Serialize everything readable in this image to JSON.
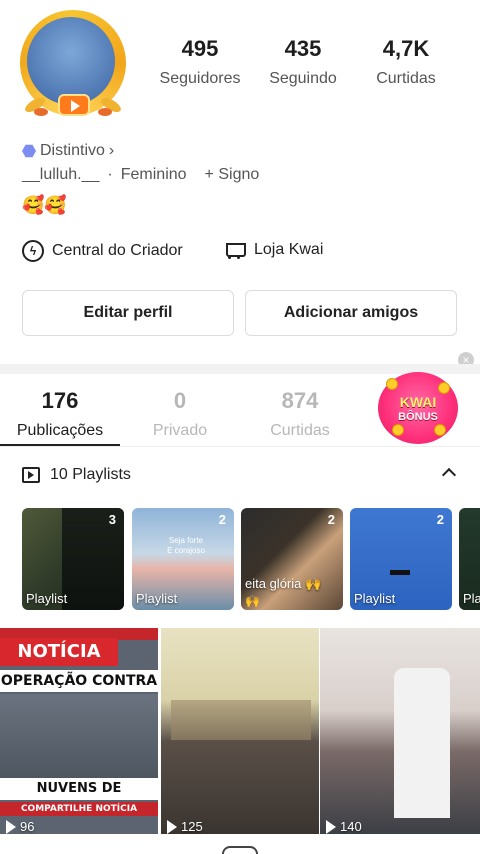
{
  "profile": {
    "stats": [
      {
        "value": "495",
        "label": "Seguidores"
      },
      {
        "value": "435",
        "label": "Seguindo"
      },
      {
        "value": "4,7K",
        "label": "Curtidas"
      }
    ],
    "distintivo": "Distintivo",
    "username": "__lulluh.__",
    "gender": "Feminino",
    "signo": "+ Signo",
    "emojis": "🥰🥰",
    "creator_center": "Central do Criador",
    "shop": "Loja Kwai",
    "edit_profile": "Editar perfil",
    "add_friends": "Adicionar amigos"
  },
  "tabs": [
    {
      "count": "176",
      "label": "Publicações",
      "active": true
    },
    {
      "count": "0",
      "label": "Privado",
      "active": false
    },
    {
      "count": "874",
      "label": "Curtidas",
      "active": false
    }
  ],
  "bonus": {
    "line1": "KWAI",
    "line2": "BÔNUS"
  },
  "playlists": {
    "header": "10 Playlists",
    "items": [
      {
        "count": "3",
        "label": "Playlist"
      },
      {
        "count": "2",
        "label": "Playlist",
        "caption": "Seja forte E corajoso"
      },
      {
        "count": "2",
        "label": "eita glória 🙌",
        "caption2": "🙌"
      },
      {
        "count": "2",
        "label": "Playlist"
      },
      {
        "count": "",
        "label": "Pla"
      }
    ]
  },
  "videos": [
    {
      "views": "96",
      "band1": "NOTÍCIA",
      "band2": "OPERAÇÃO CONTRA",
      "band3": "NUVENS DE GAFANHOTO",
      "band4": "COMPARTILHE NOTÍCIA"
    },
    {
      "views": "125"
    },
    {
      "views": "140"
    }
  ]
}
